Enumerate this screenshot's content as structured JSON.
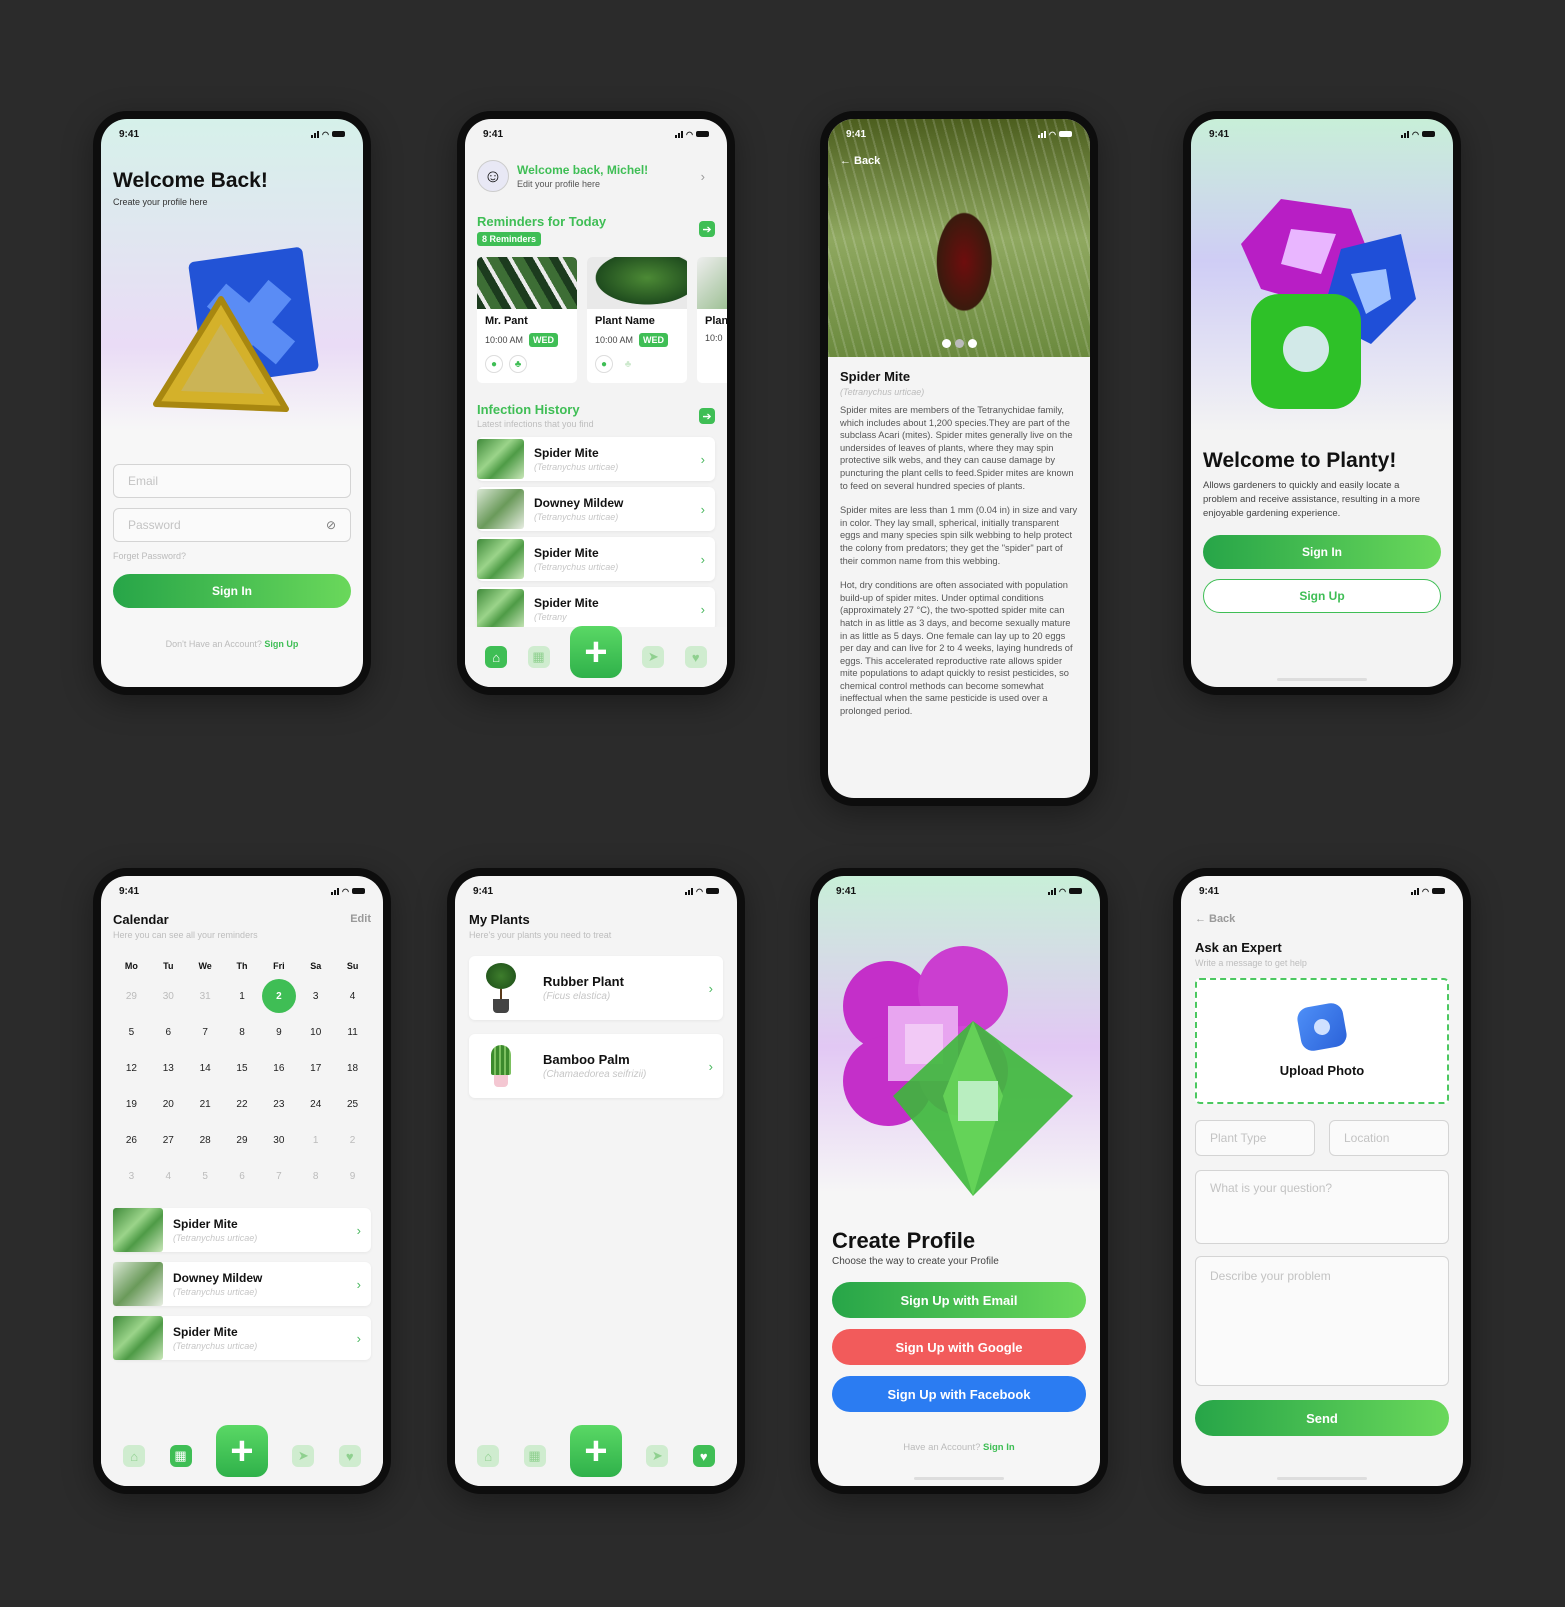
{
  "status_time": "9:41",
  "login": {
    "title": "Welcome Back!",
    "subtitle": "Create your profile here",
    "email_placeholder": "Email",
    "password_placeholder": "Password",
    "forgot": "Forget Password?",
    "sign_in": "Sign In",
    "no_account": "Don't Have an Account?",
    "sign_up": "Sign Up"
  },
  "home": {
    "greeting": "Welcome back, Michel!",
    "edit_profile": "Edit your profile here",
    "reminders_title": "Reminders for Today",
    "reminders_badge": "8 Reminders",
    "reminder_cards": [
      {
        "name": "Mr. Pant",
        "time": "10:00 AM",
        "day": "WED"
      },
      {
        "name": "Plant Name",
        "time": "10:00 AM",
        "day": "WED"
      },
      {
        "name": "Plan",
        "time": "10:0",
        "day": ""
      }
    ],
    "infection_title": "Infection History",
    "infection_sub": "Latest infections that you find",
    "infections": [
      {
        "name": "Spider Mite",
        "latin": "(Tetranychus urticae)"
      },
      {
        "name": "Downey Mildew",
        "latin": "(Tetranychus urticae)"
      },
      {
        "name": "Spider Mite",
        "latin": "(Tetranychus urticae)"
      },
      {
        "name": "Spider Mite",
        "latin": "(Tetrany"
      }
    ]
  },
  "detail": {
    "back": "Back",
    "title": "Spider Mite",
    "latin": "(Tetranychus urticae)",
    "p1": "Spider mites are members of the Tetranychidae family, which includes about 1,200 species.They are part of the subclass Acari (mites). Spider mites generally live on the undersides of leaves of plants, where they may spin protective silk webs, and they can cause damage by puncturing the plant cells to feed.Spider mites are known to feed on several hundred species of plants.",
    "p2": "Spider mites are less than 1 mm (0.04 in) in size and vary in color. They lay small, spherical, initially transparent eggs and many species spin silk webbing to help protect the colony from predators; they get the \"spider\" part of their common name from this webbing.",
    "p3": "Hot, dry conditions are often associated with population build-up of spider mites. Under optimal conditions (approximately 27 °C), the two-spotted spider mite can hatch in as little as 3 days, and become sexually mature in as little as 5 days. One female can lay up to 20 eggs per day and can live for 2 to 4 weeks, laying hundreds of eggs. This accelerated reproductive rate allows spider mite populations to adapt quickly to resist pesticides, so chemical control methods can become somewhat ineffectual when the same pesticide is used over a prolonged period."
  },
  "welcome": {
    "title": "Welcome to Planty!",
    "desc": "Allows gardeners to quickly and easily locate a problem and receive assistance, resulting in a more enjoyable gardening experience.",
    "sign_in": "Sign In",
    "sign_up": "Sign Up"
  },
  "calendar": {
    "title": "Calendar",
    "edit": "Edit",
    "sub": "Here you can see all your reminders",
    "weekdays": [
      "Mo",
      "Tu",
      "We",
      "Th",
      "Fri",
      "Sa",
      "Su"
    ],
    "days": [
      "29",
      "30",
      "31",
      "1",
      "2",
      "3",
      "4",
      "5",
      "6",
      "7",
      "8",
      "9",
      "10",
      "11",
      "12",
      "13",
      "14",
      "15",
      "16",
      "17",
      "18",
      "19",
      "20",
      "21",
      "22",
      "23",
      "24",
      "25",
      "26",
      "27",
      "28",
      "29",
      "30",
      "1",
      "2",
      "3",
      "4",
      "5",
      "6",
      "7",
      "8",
      "9"
    ],
    "selected_index": 4,
    "items": [
      {
        "name": "Spider Mite",
        "latin": "(Tetranychus urticae)"
      },
      {
        "name": "Downey Mildew",
        "latin": "(Tetranychus urticae)"
      },
      {
        "name": "Spider Mite",
        "latin": "(Tetranychus urticae)"
      }
    ]
  },
  "myplants": {
    "title": "My Plants",
    "sub": "Here's your plants you need to treat",
    "items": [
      {
        "name": "Rubber Plant",
        "latin": "(Ficus elastica)"
      },
      {
        "name": "Bamboo Palm",
        "latin": "(Chamaedorea seifrizii)"
      }
    ]
  },
  "create": {
    "title": "Create Profile",
    "sub": "Choose the way to create your Profile",
    "email": "Sign Up with Email",
    "google": "Sign Up with Google",
    "facebook": "Sign Up with Facebook",
    "have_account": "Have an Account?",
    "sign_in": "Sign In"
  },
  "expert": {
    "back": "Back",
    "title": "Ask an Expert",
    "sub": "Write a message to get help",
    "upload": "Upload Photo",
    "plant_type": "Plant Type",
    "location": "Location",
    "question": "What is your question?",
    "describe": "Describe your problem",
    "send": "Send"
  },
  "colors": {
    "accent": "#3fbe55",
    "google": "#f25b5b",
    "facebook": "#2b7cf2",
    "background": "#2b2b2b"
  }
}
